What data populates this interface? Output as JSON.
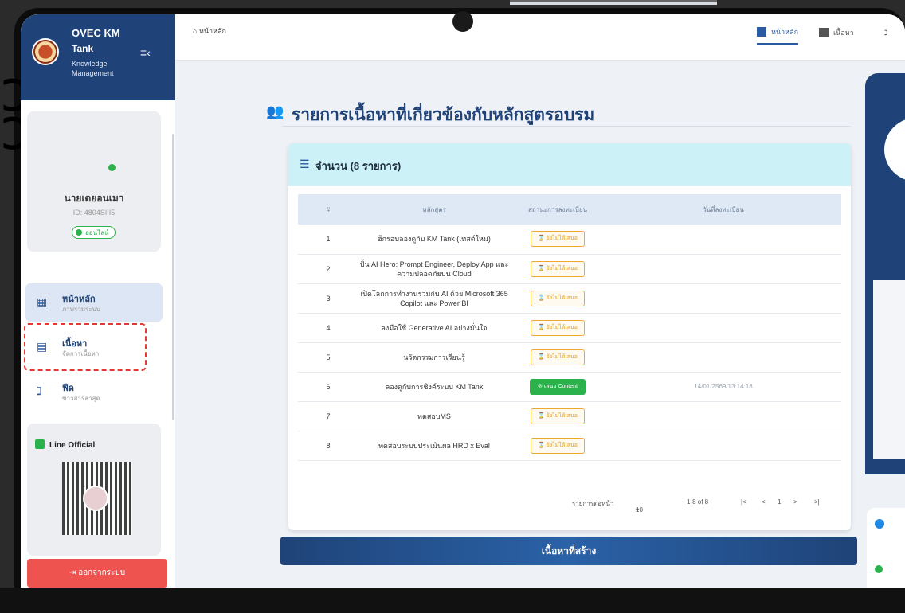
{
  "sidebar": {
    "brand": "OVEC KM",
    "app": "Tank",
    "tagline": "Knowledge Management",
    "profile": {
      "name": "นายเดยอนเมา",
      "id": "ID: 4804SIII5",
      "status": "ออนไลน์"
    },
    "nav": [
      {
        "label": "หน้าหลัก",
        "sub": "ภาพรวมระบบ"
      },
      {
        "label": "เนื้อหา",
        "sub": "จัดการเนื้อหา"
      },
      {
        "label": "ฟีด",
        "sub": "ข่าวสารล่าสุด"
      }
    ],
    "line_title": "Line Official",
    "logout": "ออกจากระบบ"
  },
  "topbar": {
    "breadcrumb": "หน้าหลัก",
    "tabs": [
      "หน้าหลัก",
      "เนื้อหา"
    ]
  },
  "main": {
    "title": "รายการเนื้อหาที่เกี่ยวข้องกับหลักสูตรอบรม",
    "card_title": "จำนวน (8 รายการ)",
    "columns": [
      "#",
      "หลักสูตร",
      "สถานะการลงทะเบียน",
      "วันที่ลงทะเบียน"
    ],
    "rows": [
      {
        "num": "1",
        "course": "ฮึกรอบลองดูกับ KM Tank (เทสต์ใหม่)",
        "status": "ยังไม่ได้เสนอ",
        "done": false,
        "date": ""
      },
      {
        "num": "2",
        "course": "ปั้น AI Hero: Prompt Engineer, Deploy App และ ความปลอดภัยบน Cloud",
        "status": "ยังไม่ได้เสนอ",
        "done": false,
        "date": ""
      },
      {
        "num": "3",
        "course": "เปิดโลกการทำงานร่วมกับ AI ด้วย Microsoft 365 Copilot และ Power BI",
        "status": "ยังไม่ได้เสนอ",
        "done": false,
        "date": ""
      },
      {
        "num": "4",
        "course": "ลงมือใช้ Generative AI อย่างมั่นใจ",
        "status": "ยังไม่ได้เสนอ",
        "done": false,
        "date": ""
      },
      {
        "num": "5",
        "course": "นวัตกรรมการเรียนรู้",
        "status": "ยังไม่ได้เสนอ",
        "done": false,
        "date": ""
      },
      {
        "num": "6",
        "course": "ลองดูกับการชิงค์ระบบ KM Tank",
        "status": "เสนอ Content",
        "done": true,
        "date": "14/01/2569/13:14:18"
      },
      {
        "num": "7",
        "course": "ทดสอบMS",
        "status": "ยังไม่ได้เสนอ",
        "done": false,
        "date": ""
      },
      {
        "num": "8",
        "course": "ทดสอบระบบประเมินผล HRD x Eval",
        "status": "ยังไม่ได้เสนอ",
        "done": false,
        "date": ""
      }
    ],
    "pager": {
      "rows_label": "รายการต่อหน้า",
      "per_page": "10",
      "range": "1-8 of 8",
      "page": "1"
    },
    "section_bar": "เนื้อหาที่สร้าง"
  }
}
